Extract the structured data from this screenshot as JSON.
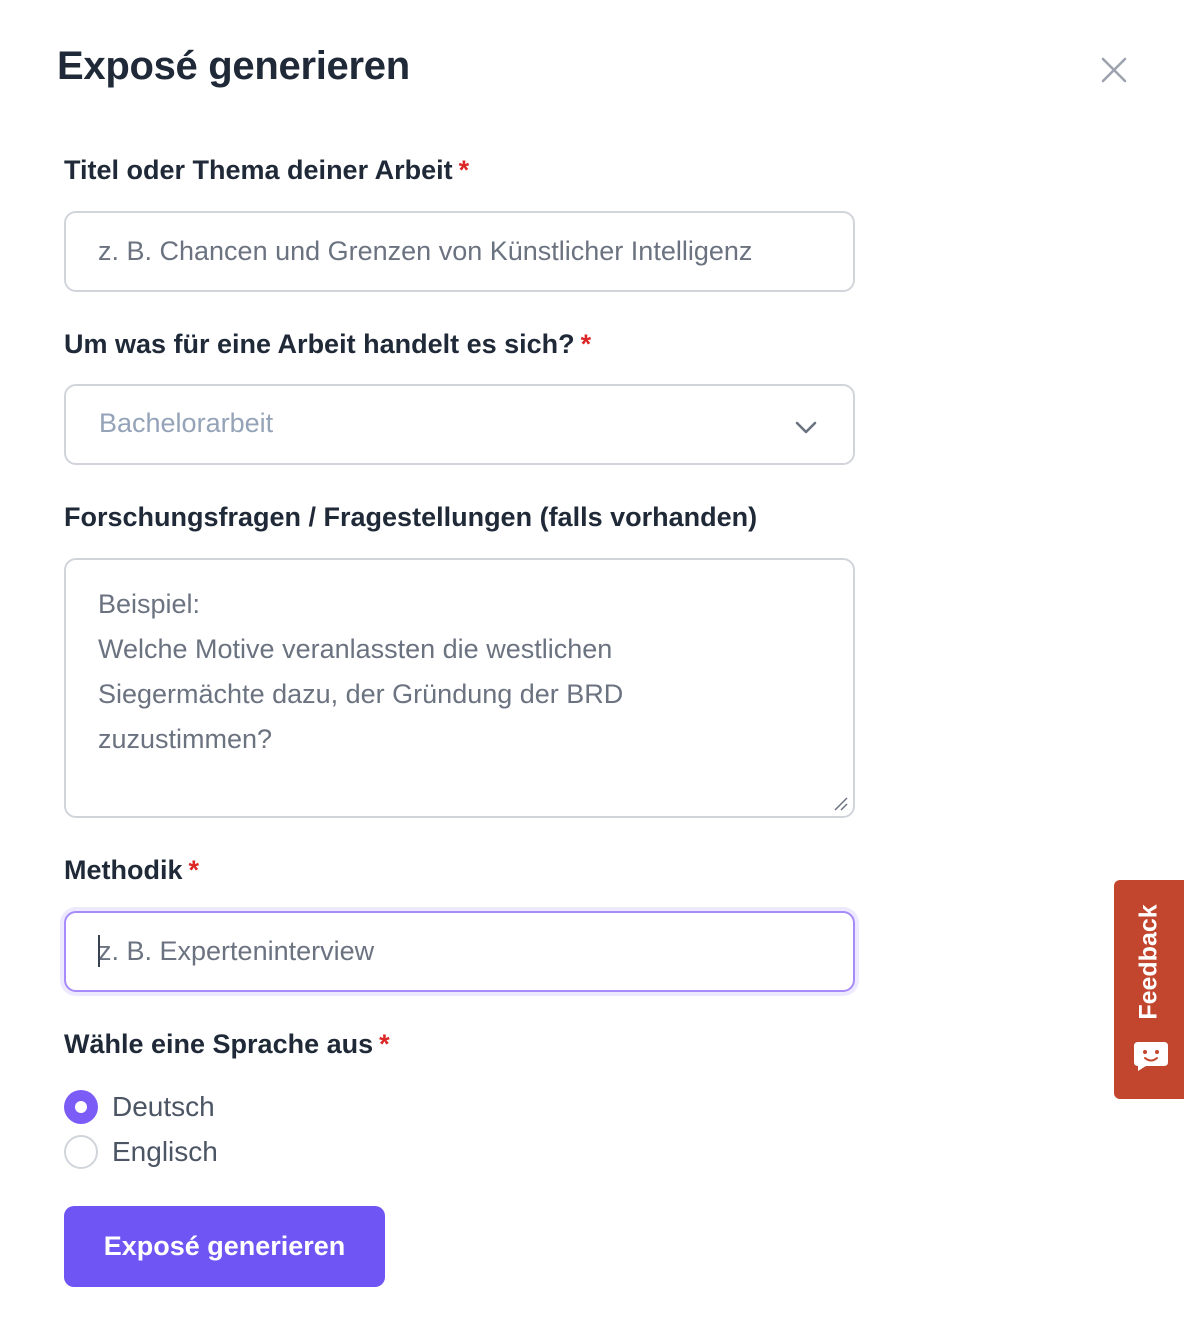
{
  "dialog": {
    "title": "Exposé generieren",
    "close_icon": "close-icon"
  },
  "form": {
    "title_field": {
      "label": "Titel oder Thema deiner Arbeit",
      "required_marker": "*",
      "value": "",
      "placeholder": "z. B. Chancen und Grenzen von Künstlicher Intelligenz"
    },
    "type_field": {
      "label": "Um was für eine Arbeit handelt es sich?",
      "required_marker": "*",
      "selected": "Bachelorarbeit",
      "icon": "chevron-down-icon"
    },
    "questions_field": {
      "label": "Forschungsfragen / Fragestellungen (falls vorhanden)",
      "placeholder_lines": [
        "Beispiel:",
        "Welche Motive veranlassten die westlichen",
        "Siegermächte dazu, der Gründung der BRD",
        "zuzustimmen?"
      ]
    },
    "method_field": {
      "label": "Methodik",
      "required_marker": "*",
      "value": "",
      "placeholder": "z. B. Experteninterview"
    },
    "language_field": {
      "label": "Wähle eine Sprache aus",
      "required_marker": "*",
      "options": [
        {
          "label": "Deutsch",
          "checked": true
        },
        {
          "label": "Englisch",
          "checked": false
        }
      ]
    },
    "submit_label": "Exposé generieren"
  },
  "feedback_tab": {
    "label": "Feedback",
    "icon": "chat-face-icon"
  },
  "colors": {
    "accent": "#7055f5",
    "required": "#dc2626",
    "feedback": "#c2452d",
    "focus_border": "#a78bfa"
  }
}
